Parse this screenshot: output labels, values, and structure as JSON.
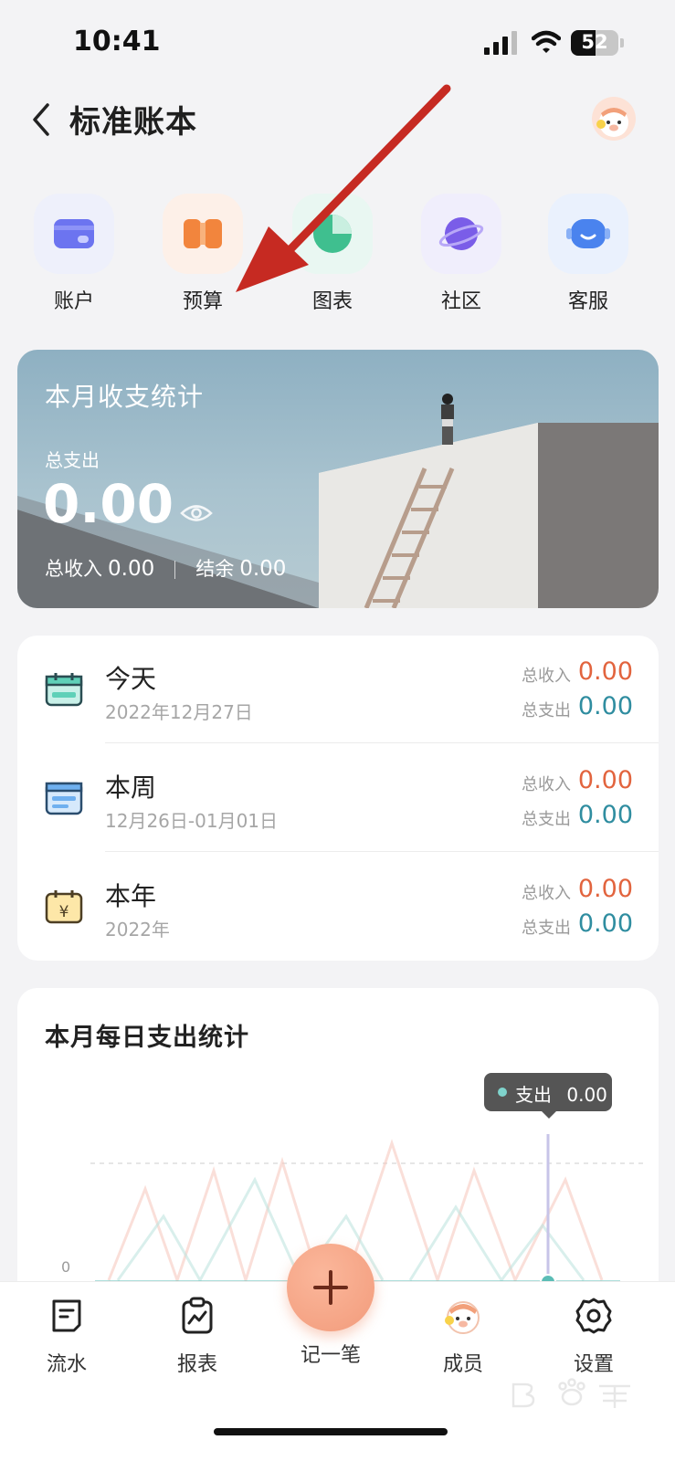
{
  "status": {
    "time": "10:41",
    "battery": "52",
    "battery_level": 0.52
  },
  "header": {
    "title": "标准账本"
  },
  "quick_actions": [
    {
      "label": "账户",
      "icon": "wallet-card-icon"
    },
    {
      "label": "预算",
      "icon": "budget-icon"
    },
    {
      "label": "图表",
      "icon": "pie-chart-icon"
    },
    {
      "label": "社区",
      "icon": "planet-icon"
    },
    {
      "label": "客服",
      "icon": "service-bot-icon"
    }
  ],
  "month_summary": {
    "title": "本月收支统计",
    "expense_label": "总支出",
    "expense_value": "0.00",
    "income_label": "总收入",
    "income_value": "0.00",
    "balance_label": "结余",
    "balance_value": "0.00"
  },
  "periods": [
    {
      "name": "今天",
      "date": "2022年12月27日",
      "income_label": "总收入",
      "income": "0.00",
      "expense_label": "总支出",
      "expense": "0.00",
      "icon": "calendar-today-icon"
    },
    {
      "name": "本周",
      "date": "12月26日-01月01日",
      "income_label": "总收入",
      "income": "0.00",
      "expense_label": "总支出",
      "expense": "0.00",
      "icon": "calendar-week-icon"
    },
    {
      "name": "本年",
      "date": "2022年",
      "income_label": "总收入",
      "income": "0.00",
      "expense_label": "总支出",
      "expense": "0.00",
      "icon": "calendar-yuan-icon"
    }
  ],
  "daily_chart": {
    "title": "本月每日支出统计",
    "zero_label": "0",
    "tooltip_label": "支出",
    "tooltip_value": "0.00"
  },
  "tabbar": {
    "items": [
      {
        "label": "流水",
        "icon": "ledger-icon"
      },
      {
        "label": "报表",
        "icon": "report-icon"
      },
      {
        "label": "记一笔",
        "icon": "plus-icon"
      },
      {
        "label": "成员",
        "icon": "member-avatar-icon"
      },
      {
        "label": "设置",
        "icon": "gear-icon"
      }
    ]
  },
  "colors": {
    "income": "#e2643e",
    "expense": "#2f8da0",
    "accent": "#f29b7b",
    "annotation_arrow": "#c62a22"
  }
}
